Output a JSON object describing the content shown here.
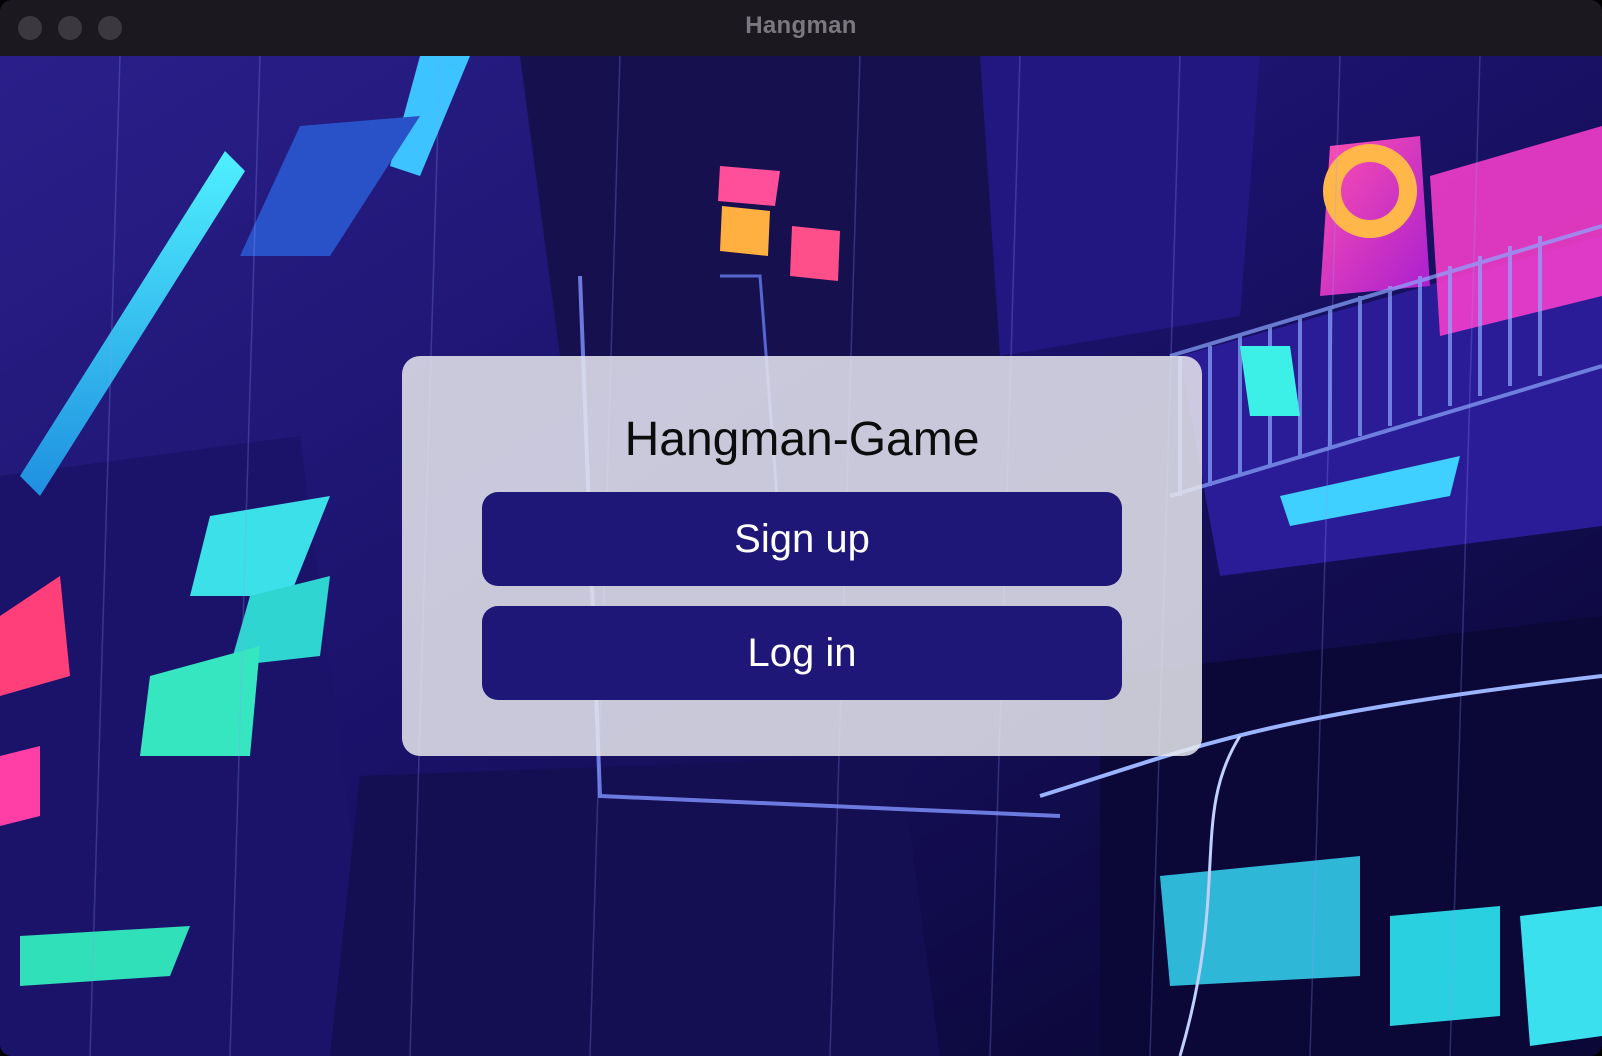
{
  "window": {
    "title": "Hangman"
  },
  "menu": {
    "heading": "Hangman-Game",
    "signup_label": "Sign up",
    "login_label": "Log in"
  },
  "colors": {
    "button_bg": "#1f1777",
    "card_bg": "#e6e6ee",
    "titlebar_bg": "#1c1820"
  }
}
